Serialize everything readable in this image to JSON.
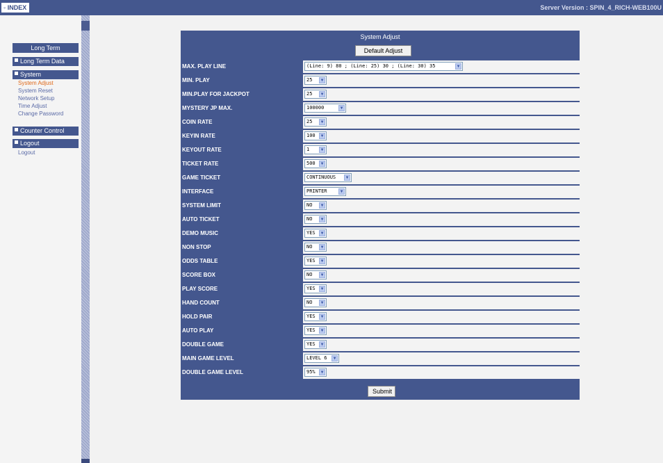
{
  "topbar": {
    "index_label": "INDEX",
    "server_version": "Server Version : SPIN_4_RICH-WEB100U"
  },
  "nav": {
    "title": "Long Term",
    "groups": [
      {
        "label": "Long Term Data"
      },
      {
        "label": "System",
        "items": [
          "System Adjust",
          "System Reset",
          "Network Setup",
          "Time Adjust",
          "Change Password"
        ]
      },
      {
        "label": "Counter Control"
      },
      {
        "label": "Logout",
        "items": [
          "Logout"
        ]
      }
    ],
    "active_item": "System Adjust"
  },
  "form": {
    "title": "System Adjust",
    "default_button": "Default Adjust",
    "submit_button": "Submit",
    "rows": [
      {
        "label": "MAX. PLAY LINE",
        "value": "(Line: 9) 80 ; (Line: 25) 30 ; (Line: 30) 35"
      },
      {
        "label": "MIN. PLAY",
        "value": "25"
      },
      {
        "label": "MIN.PLAY FOR JACKPOT",
        "value": "25"
      },
      {
        "label": "MYSTERY JP MAX.",
        "value": "100000"
      },
      {
        "label": "COIN RATE",
        "value": "25"
      },
      {
        "label": "KEYIN RATE",
        "value": "100"
      },
      {
        "label": "KEYOUT RATE",
        "value": "1"
      },
      {
        "label": "TICKET RATE",
        "value": "500"
      },
      {
        "label": "GAME TICKET",
        "value": "CONTINUOUS"
      },
      {
        "label": "INTERFACE",
        "value": "PRINTER"
      },
      {
        "label": "SYSTEM LIMIT",
        "value": "NO"
      },
      {
        "label": "AUTO TICKET",
        "value": "NO"
      },
      {
        "label": "DEMO MUSIC",
        "value": "YES"
      },
      {
        "label": "NON STOP",
        "value": "NO"
      },
      {
        "label": "ODDS TABLE",
        "value": "YES"
      },
      {
        "label": "SCORE BOX",
        "value": "NO"
      },
      {
        "label": "PLAY SCORE",
        "value": "YES"
      },
      {
        "label": "HAND COUNT",
        "value": "NO"
      },
      {
        "label": "HOLD PAIR",
        "value": "YES"
      },
      {
        "label": "AUTO PLAY",
        "value": "YES"
      },
      {
        "label": "DOUBLE GAME",
        "value": "YES"
      },
      {
        "label": "MAIN GAME LEVEL",
        "value": "LEVEL 6"
      },
      {
        "label": "DOUBLE GAME LEVEL",
        "value": "95%"
      }
    ]
  },
  "colors": {
    "header_blue": "#44578e",
    "active_link": "#e06a1a",
    "link": "#5a6aa6"
  },
  "icons": {
    "dropdown": "chevron-down-icon",
    "bullet": "square-bullet-icon"
  }
}
